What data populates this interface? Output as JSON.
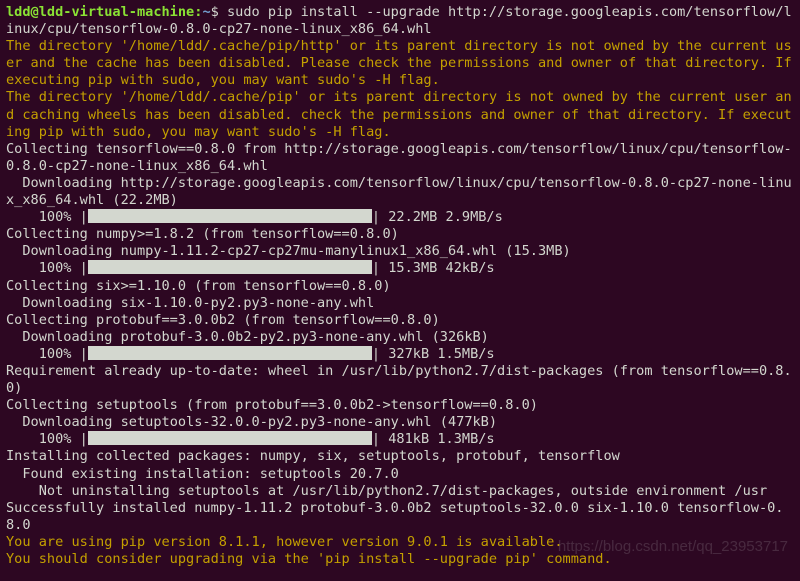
{
  "prompt": {
    "user_host": "ldd@ldd-virtual-machine",
    "path": "~",
    "cmd": "sudo pip install --upgrade http://storage.googleapis.com/tensorflow/linux/cpu/tensorflow-0.8.0-cp27-none-linux_x86_64.whl"
  },
  "warnings": {
    "w1": "The directory '/home/ldd/.cache/pip/http' or its parent directory is not owned by the current user and the cache has been disabled. Please check the permissions and owner of that directory. If executing pip with sudo, you may want sudo's -H flag.",
    "w2": "The directory '/home/ldd/.cache/pip' or its parent directory is not owned by the current user and caching wheels has been disabled. check the permissions and owner of that directory. If executing pip with sudo, you may want sudo's -H flag."
  },
  "lines": {
    "collect_tf": "Collecting tensorflow==0.8.0 from http://storage.googleapis.com/tensorflow/linux/cpu/tensorflow-0.8.0-cp27-none-linux_x86_64.whl",
    "dl_tf": "  Downloading http://storage.googleapis.com/tensorflow/linux/cpu/tensorflow-0.8.0-cp27-none-linux_x86_64.whl (22.2MB)",
    "collect_numpy": "Collecting numpy>=1.8.2 (from tensorflow==0.8.0)",
    "dl_numpy": "  Downloading numpy-1.11.2-cp27-cp27mu-manylinux1_x86_64.whl (15.3MB)",
    "collect_six": "Collecting six>=1.10.0 (from tensorflow==0.8.0)",
    "dl_six": "  Downloading six-1.10.0-py2.py3-none-any.whl",
    "collect_protobuf": "Collecting protobuf==3.0.0b2 (from tensorflow==0.8.0)",
    "dl_protobuf": "  Downloading protobuf-3.0.0b2-py2.py3-none-any.whl (326kB)",
    "req_wheel": "Requirement already up-to-date: wheel in /usr/lib/python2.7/dist-packages (from tensorflow==0.8.0)",
    "collect_setuptools": "Collecting setuptools (from protobuf==3.0.0b2->tensorflow==0.8.0)",
    "dl_setuptools": "  Downloading setuptools-32.0.0-py2.py3-none-any.whl (477kB)",
    "installing": "Installing collected packages: numpy, six, setuptools, protobuf, tensorflow",
    "found_existing": "  Found existing installation: setuptools 20.7.0",
    "not_uninstall": "    Not uninstalling setuptools at /usr/lib/python2.7/dist-packages, outside environment /usr",
    "success": "Successfully installed numpy-1.11.2 protobuf-3.0.0b2 setuptools-32.0.0 six-1.10.0 tensorflow-0.8.0"
  },
  "progress": {
    "p1": {
      "pct": "    100% |",
      "tail": "| 22.2MB 2.9MB/s "
    },
    "p2": {
      "pct": "    100% |",
      "tail": "| 15.3MB 42kB/s "
    },
    "p3": {
      "pct": "    100% |",
      "tail": "| 327kB 1.5MB/s "
    },
    "p4": {
      "pct": "    100% |",
      "tail": "| 481kB 1.3MB/s "
    }
  },
  "footer": {
    "v1": "You are using pip version 8.1.1, however version 9.0.1 is available.",
    "v2": "You should consider upgrading via the 'pip install --upgrade pip' command."
  },
  "watermark": "https://blog.csdn.net/qq_23953717"
}
